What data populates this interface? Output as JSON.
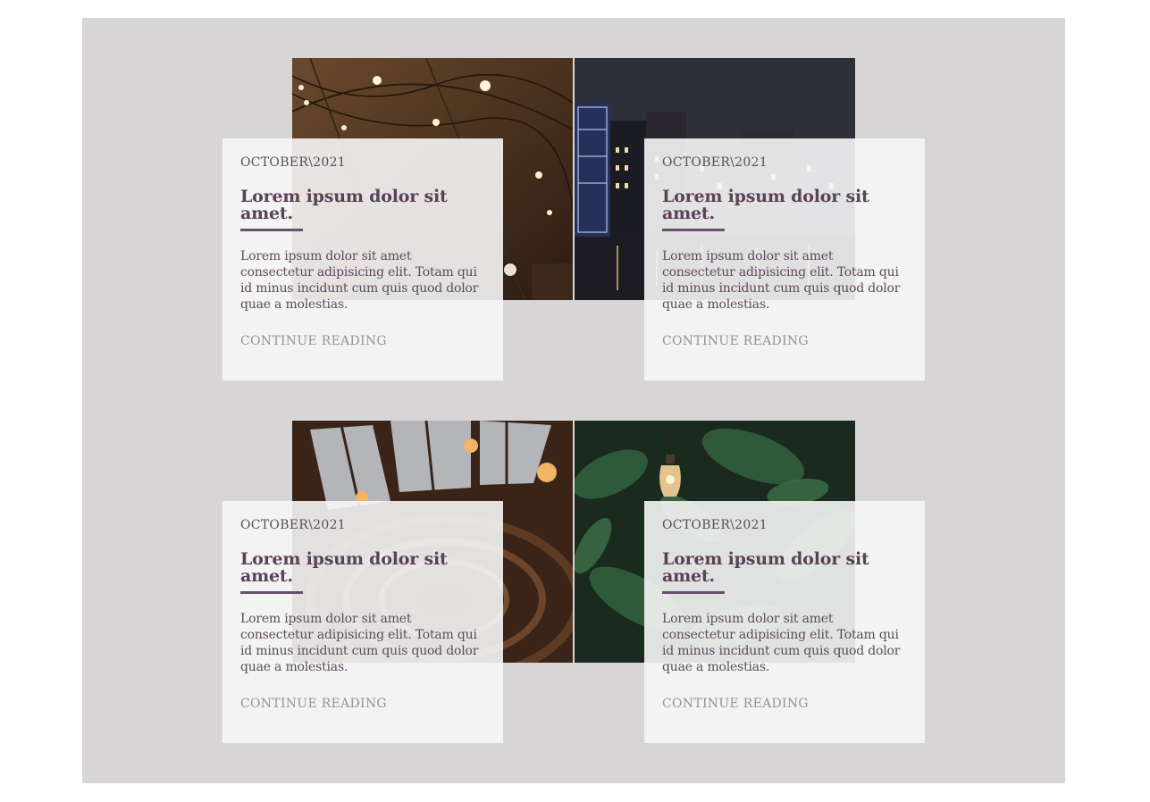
{
  "posts": [
    {
      "photo": "string-lights-cellar-photo",
      "date": "OCTOBER\\2021",
      "title": "Lorem ipsum dolor sit amet.",
      "body": "Lorem ipsum dolor sit amet consectetur adipisicing elit. Totam qui id minus incidunt cum quis quod dolor quae a molestias.",
      "link": "CONTINUE READING"
    },
    {
      "photo": "canal-houses-night-photo",
      "date": "OCTOBER\\2021",
      "title": "Lorem ipsum dolor sit amet.",
      "body": "Lorem ipsum dolor sit amet consectetur adipisicing elit. Totam qui id minus incidunt cum quis quod dolor quae a molestias.",
      "link": "CONTINUE READING"
    },
    {
      "photo": "spiral-staircase-photo",
      "date": "OCTOBER\\2021",
      "title": "Lorem ipsum dolor sit amet.",
      "body": "Lorem ipsum dolor sit amet consectetur adipisicing elit. Totam qui id minus incidunt cum quis quod dolor quae a molestias.",
      "link": "CONTINUE READING"
    },
    {
      "photo": "light-bulb-leaves-photo",
      "date": "OCTOBER\\2021",
      "title": "Lorem ipsum dolor sit amet.",
      "body": "Lorem ipsum dolor sit amet consectetur adipisicing elit. Totam qui id minus incidunt cum quis quod dolor quae a molestias.",
      "link": "CONTINUE READING"
    }
  ],
  "colors": {
    "page_background": "#d7d5d6",
    "card_background": "#f6f6f6",
    "title": "#5a4158",
    "accent_divider": "#67506a",
    "body_text": "#5d4a5b",
    "link": "#9a8f98"
  }
}
